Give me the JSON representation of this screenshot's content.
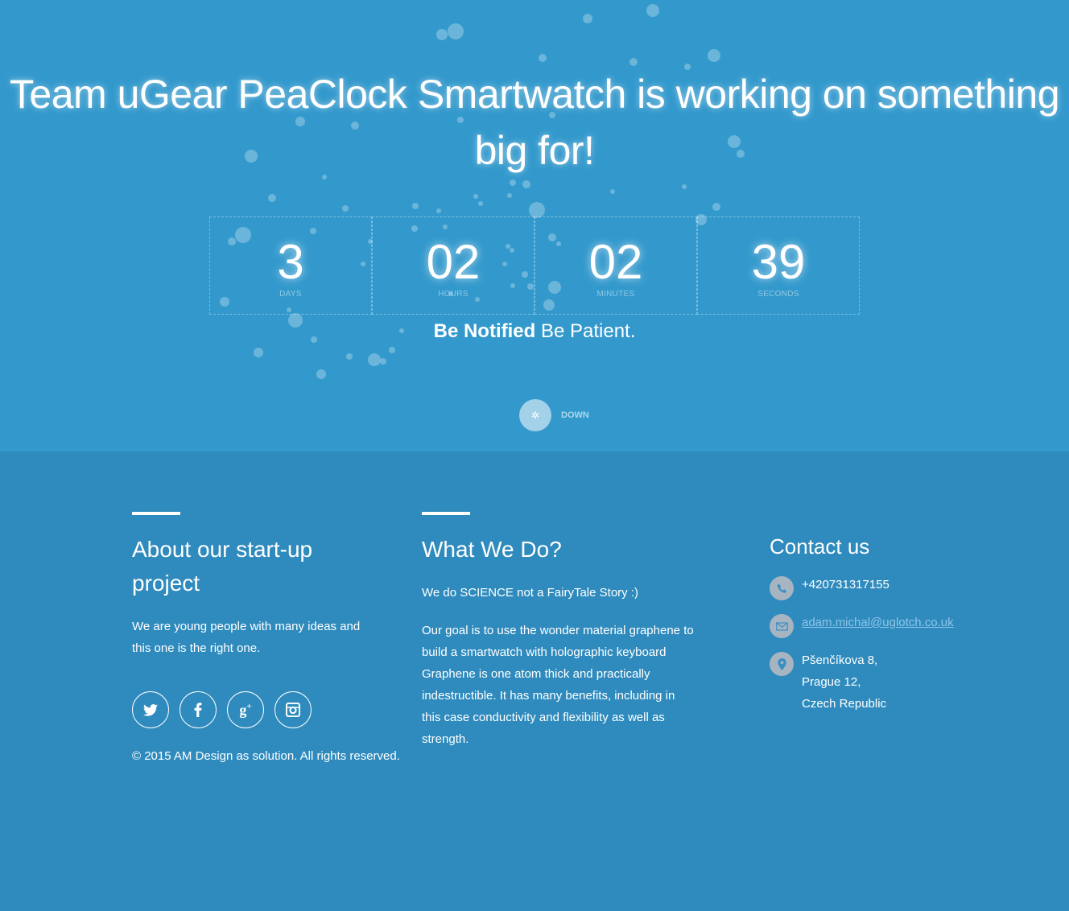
{
  "hero": {
    "headline": "Team uGear PeaClock Smartwatch is working on something big for!",
    "countdown": [
      {
        "value": "3",
        "label": "DAYS"
      },
      {
        "value": "02",
        "label": "HOURS"
      },
      {
        "value": "02",
        "label": "MINUTES"
      },
      {
        "value": "39",
        "label": "SECONDS"
      }
    ],
    "notify_bold": "Be Notified",
    "notify_rest": " Be Patient.",
    "down_label": "DOWN",
    "down_icon": "gear-icon"
  },
  "about": {
    "title": "About our start-up project",
    "description": "We are young people with many ideas and this one is the right one.",
    "socials": [
      {
        "name": "twitter-icon",
        "glyph": "t"
      },
      {
        "name": "facebook-icon",
        "glyph": "f"
      },
      {
        "name": "google-plus-icon",
        "glyph": "g+"
      },
      {
        "name": "instagram-icon",
        "glyph": "◘"
      }
    ],
    "copyright": "© 2015 AM Design as solution. All rights reserved."
  },
  "what": {
    "title": "What We Do?",
    "tagline": "We do SCIENCE not a FairyTale Story :)",
    "goal": "Our goal is to use the wonder material graphene to build a smartwatch with holographic keyboard Graphene is one atom thick and practically indestructible. It has many benefits, including in this case conductivity and flexibility as well as strength."
  },
  "contact": {
    "title": "Contact us",
    "phone": "+420731317155",
    "email": "adam.michal@uglotch.co.uk",
    "address_line1": "Pšenčíkova 8,",
    "address_line2": "Prague 12,",
    "address_line3": "Czech Republic"
  },
  "colors": {
    "hero_bg": "#3399cc",
    "footer_bg": "#2f8bbd",
    "contact_icon_bg": "#a7b4c1",
    "link": "#8ec5ea"
  }
}
